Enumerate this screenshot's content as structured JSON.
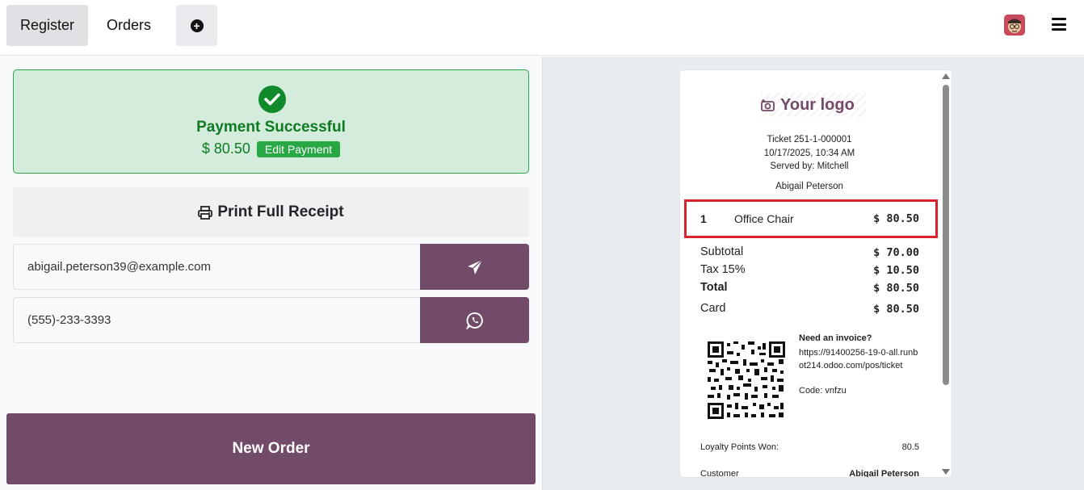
{
  "header": {
    "tabs": [
      {
        "label": "Register",
        "active": true
      },
      {
        "label": "Orders",
        "active": false
      }
    ],
    "add_icon": "plus-circle-icon",
    "menu_icon": "hamburger-icon"
  },
  "payment": {
    "title": "Payment Successful",
    "amount": "$ 80.50",
    "edit_label": "Edit Payment"
  },
  "actions": {
    "print_label": "Print Full Receipt",
    "email_value": "abigail.peterson39@example.com",
    "phone_value": "(555)-233-3393",
    "new_order_label": "New Order"
  },
  "receipt": {
    "logo_text": "Your logo",
    "ticket": "Ticket 251-1-000001",
    "datetime": "10/17/2025, 10:34 AM",
    "served_by": "Served by: Mitchell",
    "customer_name": "Abigail Peterson",
    "line": {
      "qty": "1",
      "product": "Office Chair",
      "price": "$ 80.50"
    },
    "totals": [
      {
        "label": "Subtotal",
        "value": "$ 70.00",
        "bold": false
      },
      {
        "label": "Tax 15%",
        "value": "$ 10.50",
        "bold": false
      },
      {
        "label": "Total",
        "value": "$ 80.50",
        "bold": true
      }
    ],
    "payment_method": {
      "label": "Card",
      "value": "$ 80.50"
    },
    "invoice": {
      "title": "Need an invoice?",
      "url": "https://91400256-19-0-all.runbot214.odoo.com/pos/ticket",
      "code": "Code: vnfzu"
    },
    "loyalty": {
      "label": "Loyalty Points Won:",
      "value": "80.5"
    },
    "customer_row": {
      "label": "Customer",
      "value": "Abigail Peterson"
    }
  },
  "colors": {
    "brand": "#714b67",
    "success": "#28a745",
    "highlight": "#d9222b"
  }
}
